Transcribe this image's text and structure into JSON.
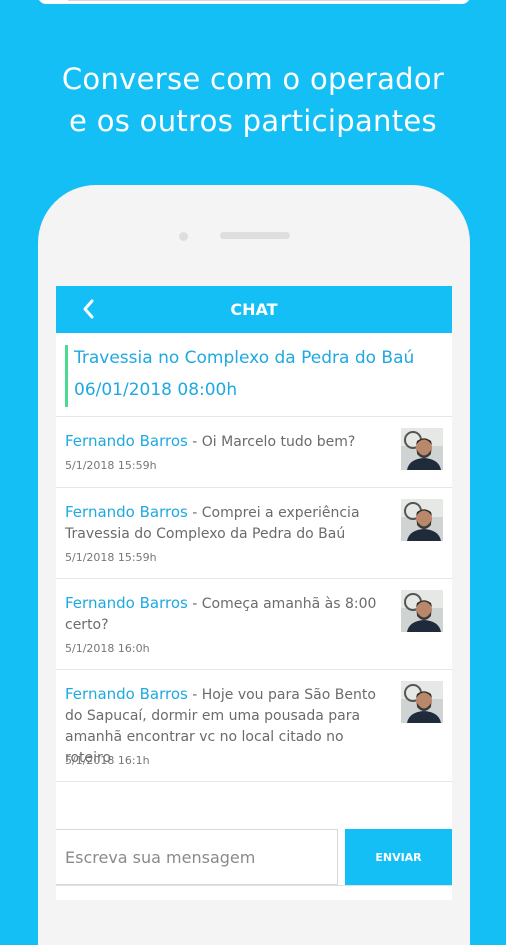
{
  "headline": {
    "line1": "Converse com o operador",
    "line2": "e os outros participantes"
  },
  "appbar": {
    "title": "CHAT",
    "back_icon": "chevron-left-icon"
  },
  "event": {
    "title": "Travessia no Complexo da Pedra do Baú",
    "datetime": "06/01/2018 08:00h"
  },
  "messages": [
    {
      "sender": "Fernando Barros",
      "text": " - Oi Marcelo tudo bem?",
      "time": "5/1/2018 15:59h"
    },
    {
      "sender": "Fernando Barros",
      "text": " - Comprei a experiência Travessia do Complexo da Pedra do Baú",
      "time": "5/1/2018 15:59h"
    },
    {
      "sender": "Fernando Barros",
      "text": " - Começa amanhã às 8:00 certo?",
      "time": "5/1/2018 16:0h"
    },
    {
      "sender": "Fernando Barros",
      "text": " - Hoje vou para São Bento do Sapucaí, dormir em uma pousada para amanhã encontrar vc no local citado no roteiro",
      "time": "5/1/2018 16:1h"
    }
  ],
  "composer": {
    "placeholder": "Escreva sua mensagem",
    "send_label": "ENVIAR"
  },
  "colors": {
    "brand": "#14bff5",
    "link": "#1ea9e1",
    "accent_bar": "#4cd991"
  }
}
